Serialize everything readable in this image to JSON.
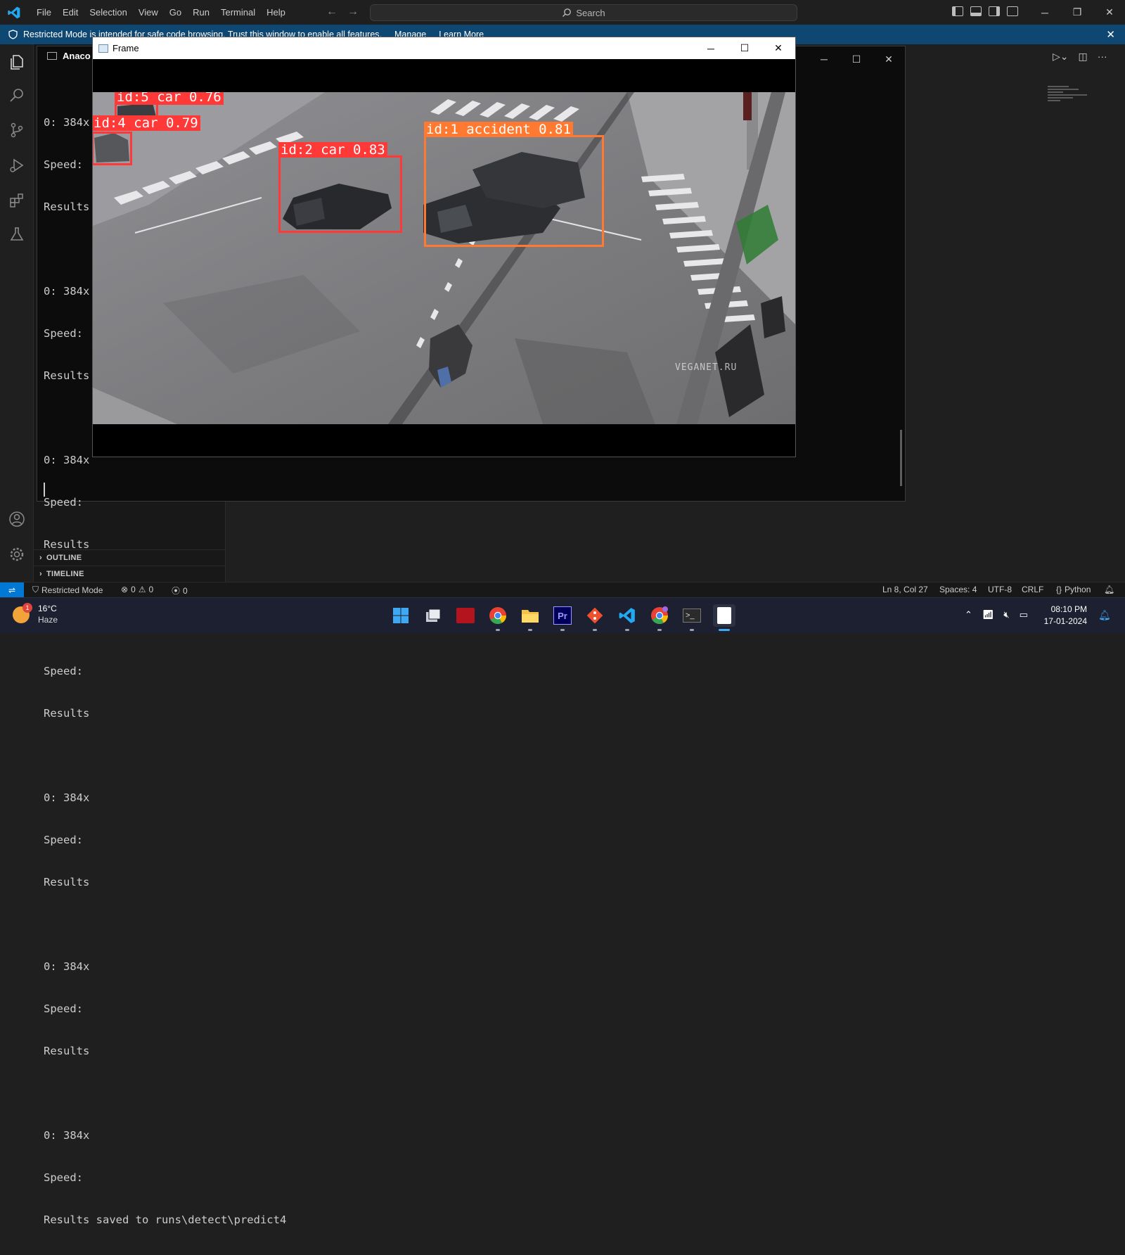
{
  "menu": [
    "File",
    "Edit",
    "Selection",
    "View",
    "Go",
    "Run",
    "Terminal",
    "Help"
  ],
  "search": {
    "label": "Search"
  },
  "banner": {
    "text": "Restricted Mode is intended for safe code browsing. Trust this window to enable all features.",
    "manage": "Manage",
    "learn_more": "Learn More"
  },
  "terminal": {
    "tab_label": "Anaco",
    "lines": [
      "0: 384x",
      "Speed:",
      "Results",
      "0: 384x",
      "Speed:",
      "Results",
      "0: 384x",
      "Speed:",
      "Results",
      "0: 384x",
      "Speed:",
      "Results",
      "0: 384x",
      "Speed:",
      "Results",
      "0: 384x",
      "Speed:",
      "Results",
      "0: 384x",
      "Speed:"
    ],
    "last_line": "Results saved to runs\\detect\\predict4"
  },
  "frame": {
    "title": "Frame",
    "detections": [
      {
        "label": "id:5 car 0.76",
        "color": "#ff3838"
      },
      {
        "label": "id:4 car 0.79",
        "color": "#ff3838"
      },
      {
        "label": "id:2 car 0.83",
        "color": "#ff3838"
      },
      {
        "label": "id:1 accident 0.81",
        "color": "#ff7a30"
      }
    ],
    "watermark": "VEGANET.RU"
  },
  "sidebar": {
    "outline": "OUTLINE",
    "timeline": "TIMELINE"
  },
  "statusbar": {
    "restricted": "Restricted Mode",
    "errors": "0",
    "warnings": "0",
    "ports": "0",
    "position": "Ln 8, Col 27",
    "spaces": "Spaces: 4",
    "encoding": "UTF-8",
    "eol": "CRLF",
    "language": "Python"
  },
  "taskbar": {
    "weather_temp": "16°C",
    "weather_desc": "Haze",
    "weather_badge": "1",
    "time": "08:10 PM",
    "date": "17-01-2024"
  },
  "colors": {
    "accent": "#0078d4",
    "banner": "#0e4772",
    "car_box": "#ff3838",
    "accident_box": "#ff7a30"
  }
}
